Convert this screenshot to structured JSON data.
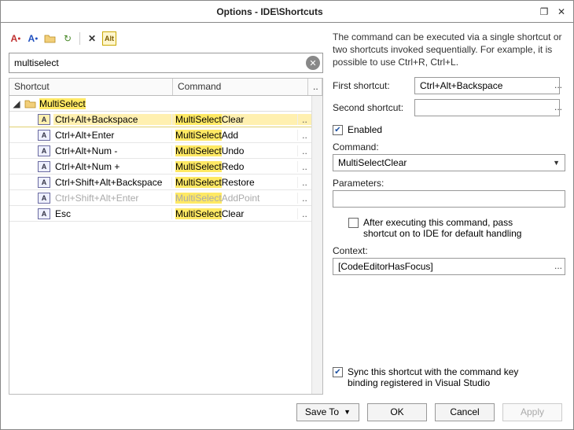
{
  "window": {
    "title": "Options - IDE\\Shortcuts"
  },
  "toolbar": {
    "icons": [
      "font-red-icon",
      "font-blue-icon",
      "folder-icon",
      "recent-icon",
      "close-icon",
      "alt-icon"
    ],
    "alt_label": "Alt"
  },
  "search": {
    "value": "multiselect"
  },
  "grid": {
    "col_shortcut": "Shortcut",
    "col_command": "Command",
    "col_more": "..",
    "group_label": "MultiSelect",
    "rows": [
      {
        "shortcut": "Ctrl+Alt+Backspace",
        "cmd_hl": "MultiSelect",
        "cmd_rest": "Clear",
        "selected": true,
        "dim": false
      },
      {
        "shortcut": "Ctrl+Alt+Enter",
        "cmd_hl": "MultiSelect",
        "cmd_rest": "Add",
        "selected": false,
        "dim": false
      },
      {
        "shortcut": "Ctrl+Alt+Num -",
        "cmd_hl": "MultiSelect",
        "cmd_rest": "Undo",
        "selected": false,
        "dim": false
      },
      {
        "shortcut": "Ctrl+Alt+Num +",
        "cmd_hl": "MultiSelect",
        "cmd_rest": "Redo",
        "selected": false,
        "dim": false
      },
      {
        "shortcut": "Ctrl+Shift+Alt+Backspace",
        "cmd_hl": "MultiSelect",
        "cmd_rest": "Restore",
        "selected": false,
        "dim": false
      },
      {
        "shortcut": "Ctrl+Shift+Alt+Enter",
        "cmd_hl": "MultiSelect",
        "cmd_rest": "AddPoint",
        "selected": false,
        "dim": true
      },
      {
        "shortcut": "Esc",
        "cmd_hl": "MultiSelect",
        "cmd_rest": "Clear",
        "selected": false,
        "dim": false
      }
    ],
    "more_cell": ".."
  },
  "details": {
    "description": "The command can be executed via a single shortcut or two shortcuts invoked sequentially. For example, it is possible to use Ctrl+R, Ctrl+L.",
    "first_label": "First shortcut:",
    "first_value": "Ctrl+Alt+Backspace",
    "second_label": "Second shortcut:",
    "second_value": "",
    "enabled_label": "Enabled",
    "enabled_checked": true,
    "command_label": "Command:",
    "command_value": "MultiSelectClear",
    "parameters_label": "Parameters:",
    "parameters_value": "",
    "pass_label": "After executing this command, pass shortcut on to IDE for default handling",
    "pass_checked": false,
    "context_label": "Context:",
    "context_value": "[CodeEditorHasFocus]",
    "sync_label": "Sync this shortcut with the command key binding registered in Visual Studio",
    "sync_checked": true,
    "ell": "..."
  },
  "footer": {
    "save_to": "Save To",
    "ok": "OK",
    "cancel": "Cancel",
    "apply": "Apply"
  }
}
